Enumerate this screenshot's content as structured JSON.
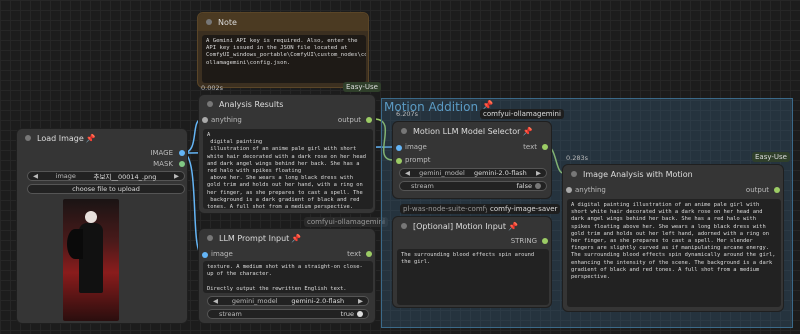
{
  "note": {
    "title": "Note",
    "text": "A Gemini API key is required. Also, enter the API key issued in the JSON file located at ComfyUI_windows_portable\\ComfyUI\\custom_nodes\\comfyui-ollamagemini\\config.json."
  },
  "badges": {
    "easy_use_1": "Easy-Use",
    "easy_use_2": "Easy-Use",
    "ollamagemini_1": "comfyui-ollamagemini",
    "ollamagemini_2": "comfyui-ollamagemini",
    "image_saver": "comfy-image-saver",
    "pl_was": "pl-was-node-suite-comfyui"
  },
  "analysis": {
    "time": "0.002s",
    "title": "Analysis Results",
    "input": "anything",
    "output": "output",
    "text": "A\n digital painting\n illustration of an anime pale girl with short white hair decorated with a dark rose on her head and dark angel wings behind her back. She has a red halo with spikes floating\n above her. She wears a long black dress with gold trim and holds out her hand, with a ring on her finger, as she prepares to cast a spell. The\n background is a dark gradient of black and red tones. A full shot from a medium perspective."
  },
  "load_image": {
    "title": "Load Image",
    "out_image": "IMAGE",
    "out_mask": "MASK",
    "image_label": "image",
    "image_value": "추보지__00014_.png",
    "upload_label": "choose file to upload"
  },
  "llm_prompt": {
    "title": "LLM Prompt Input",
    "input": "image",
    "output": "text",
    "text": "texture. A medium shot with a straight-on close-up of the character.\n\nDirectly output the rewritten English text.",
    "model_label": "gemini_model",
    "model_value": "gemini-2.0-flash",
    "stream_label": "stream",
    "stream_value": "true"
  },
  "group": {
    "title": "Motion Addition"
  },
  "motion_llm": {
    "time": "6.207s",
    "title": "Motion LLM Model Selector",
    "input_image": "image",
    "input_prompt": "prompt",
    "output": "text",
    "model_label": "gemini_model",
    "model_value": "gemini-2.0-flash",
    "stream_label": "stream",
    "stream_value": "false"
  },
  "motion_input": {
    "title": "[Optional] Motion Input",
    "output": "STRING",
    "text": "The surrounding blood effects spin around the girl."
  },
  "image_analysis": {
    "time": "0.283s",
    "title": "Image Analysis with Motion",
    "input": "anything",
    "output": "output",
    "text": "A digital painting illustration of an anime pale girl with short white hair decorated with a dark rose on her head and dark angel wings behind her back. She has a red halo with spikes floating above her. She wears a long black dress with gold trim and holds out her left hand, adorned with a ring on her finger, as she prepares to cast a spell. Her slender fingers are slightly curved as if manipulating arcane energy. The surrounding blood effects spin dynamically around the girl, enhancing the intensity of the scene. The background is a dark gradient of black and red tones. A full shot from a medium perspective."
  }
}
